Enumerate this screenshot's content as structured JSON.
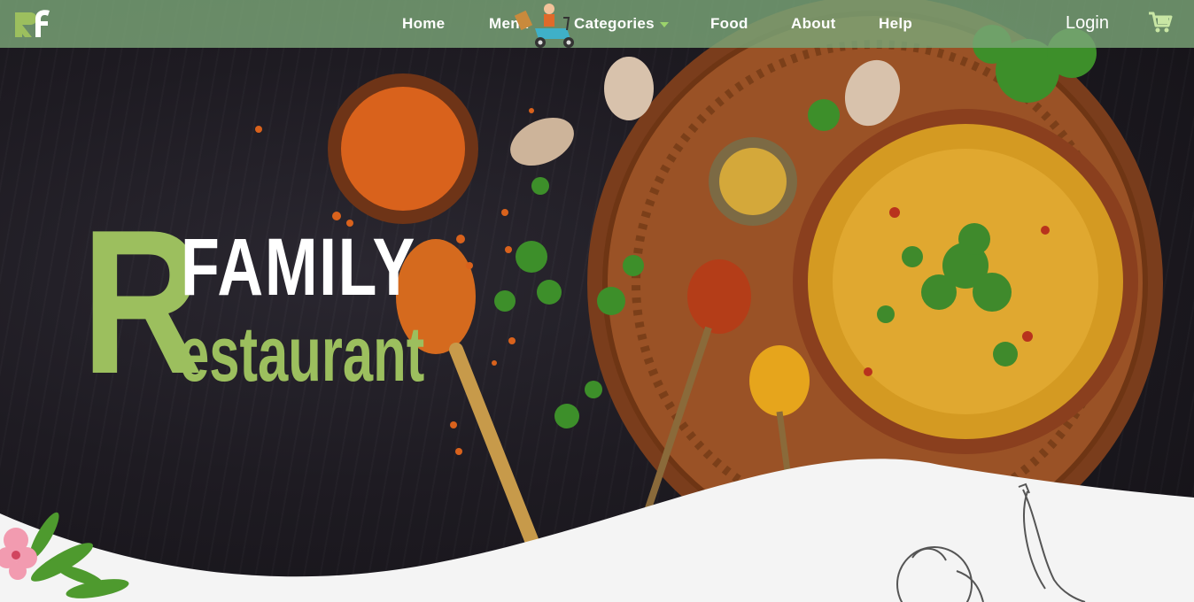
{
  "navbar": {
    "logo_text": "Rf",
    "links": [
      {
        "label": "Home"
      },
      {
        "label": "Menu"
      },
      {
        "label": "Categories"
      },
      {
        "label": "Food"
      },
      {
        "label": "About"
      },
      {
        "label": "Help"
      }
    ],
    "login_label": "Login",
    "cart_icon": "cart-icon",
    "accent_color": "#7aa578",
    "caret_color": "#9bd36b"
  },
  "hero": {
    "title_letter": "R",
    "title_line1": "FAMILY",
    "title_line2": "estaurant",
    "title_green": "#9cbf5e",
    "title_white": "#ffffff"
  }
}
